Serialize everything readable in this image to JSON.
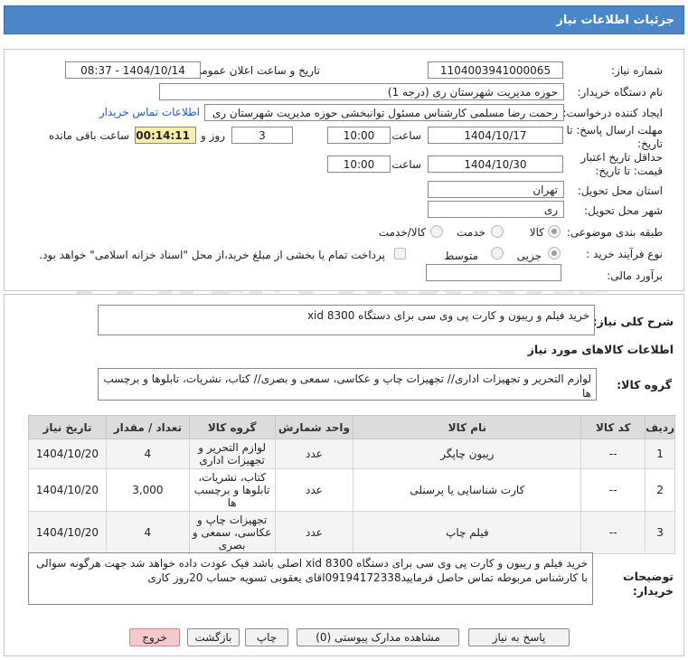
{
  "window": {
    "title": "جزئیات اطلاعات نیاز"
  },
  "form": {
    "need_number_label": "شماره نیاز:",
    "need_number": "1104003941000065",
    "announce_label": "تاریخ و ساعت اعلان عمومی:",
    "announce_value": "1404/10/14 - 08:37",
    "buyer_org_label": "نام دستگاه خریدار:",
    "buyer_org": "حوزه مدیریت   شهرستان ری (درجه 1)",
    "creator_label": "ایجاد کننده درخواست:",
    "creator": "رحمت رضا مسلمی کارشناس مسئول توانبخشی حوزه مدیریت   شهرستان ری",
    "contact_link": "اطلاعات تماس خریدار",
    "deadline_label_1": "مهلت ارسال پاسخ: تا",
    "deadline_label_2": "تاریخ:",
    "deadline_date": "1404/10/17",
    "time_label": "ساعت",
    "deadline_time": "10:00",
    "days_value": "3",
    "days_label": "روز و",
    "remaining_time": "00:14:11",
    "remaining_label": "ساعت باقی مانده",
    "validity_label_1": "حداقل تاریخ اعتبار",
    "validity_label_2": "قیمت: تا تاریخ:",
    "validity_date": "1404/10/30",
    "validity_time": "10:00",
    "province_label": "استان محل تحویل:",
    "province": "تهران",
    "city_label": "شهر محل تحویل:",
    "city": "ری",
    "category_label": "طبقه بندی موضوعی:",
    "category_options": [
      "کالا",
      "خدمت",
      "کالا/خدمت"
    ],
    "process_label": "نوع فرآیند خرید :",
    "process_options": [
      "جزیی",
      "متوسط"
    ],
    "payment_note": "پرداخت تمام یا بخشی از مبلغ خرید،از محل \"اسناد خزانه اسلامی\" خواهد بود.",
    "estimate_label": "برآورد مالی:",
    "estimate_value": ""
  },
  "details": {
    "summary_label": "شرح کلی نیاز:",
    "summary": "خرید فیلم و ریبون  و کارت پی وی سی برای دستگاه xid 8300",
    "goods_info_title": "اطلاعات کالاهای مورد نیاز",
    "goods_group_label": "گروه کالا:",
    "goods_group": "لوازم التحریر و تجهیزات اداری// تجهیزات چاپ و عکاسی، سمعی و بصری// کتاب، نشریات، تابلوها و برچسب ها",
    "table": {
      "headers": [
        "ردیف",
        "کد کالا",
        "نام کالا",
        "واحد شمارش",
        "گروه کالا",
        "تعداد / مقدار",
        "تاریخ نیاز"
      ],
      "rows": [
        {
          "row": "1",
          "code": "--",
          "name": "ریبون چاپگر",
          "unit": "عدد",
          "group": "لوازم التحریر و تجهیزات اداری",
          "qty": "4",
          "date": "1404/10/20"
        },
        {
          "row": "2",
          "code": "--",
          "name": "کارت شناسایی یا پرسنلی",
          "unit": "عدد",
          "group": "کتاب، نشریات، تابلوها و برچسب ها",
          "qty": "3,000",
          "date": "1404/10/20"
        },
        {
          "row": "3",
          "code": "--",
          "name": "فیلم چاپ",
          "unit": "عدد",
          "group": "تجهیزات چاپ و عکاسی، سمعی و بصری",
          "qty": "4",
          "date": "1404/10/20"
        }
      ]
    },
    "buyer_notes_label_1": "توضیحات",
    "buyer_notes_label_2": "خریدار:",
    "buyer_notes": "خرید فیلم و ریبون  و کارت پی وی سی برای دستگاه xid 8300 اصلی باشد فیک عودت داده خواهد شد جهت هرگونه سوالی با کارشناس مربوطه تماس حاصل فرمایید09194172338اقای یعقوبی تسویه حساب 20روز کاری"
  },
  "buttons": {
    "reply": "پاسخ به نیاز",
    "attachments": "مشاهده مدارک پیوستی (0)",
    "print": "چاپ",
    "back": "بازگشت",
    "exit": "خروج"
  },
  "colors": {
    "titlebar": "#4a86c8",
    "remaining_bg": "#f9efaa",
    "exit_bg": "#f6c9cc",
    "link": "#1a5bd6"
  }
}
